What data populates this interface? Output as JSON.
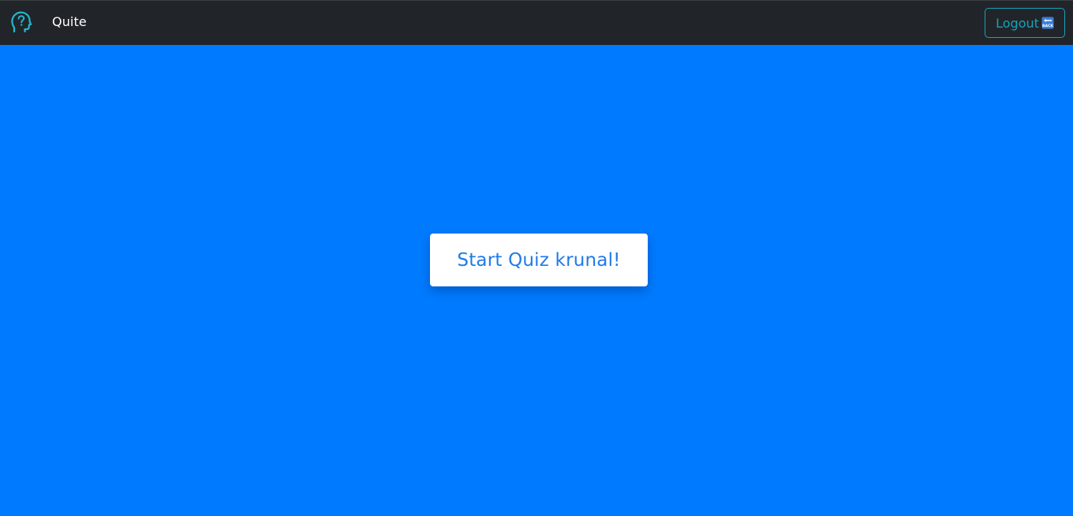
{
  "navbar": {
    "brand_icon": "question-head-icon",
    "brand_name": "Quite",
    "logout_label": "Logout",
    "logout_icon": "back-arrow-icon",
    "logout_icon_text": "BACK",
    "colors": {
      "background": "#212529",
      "accent": "#17a2b8",
      "brand_text": "#ffffff"
    }
  },
  "main": {
    "start_button_label": "Start Quiz krunal!",
    "colors": {
      "background": "#007bff",
      "button_background": "#ffffff",
      "button_text": "#1f7ae8"
    }
  }
}
